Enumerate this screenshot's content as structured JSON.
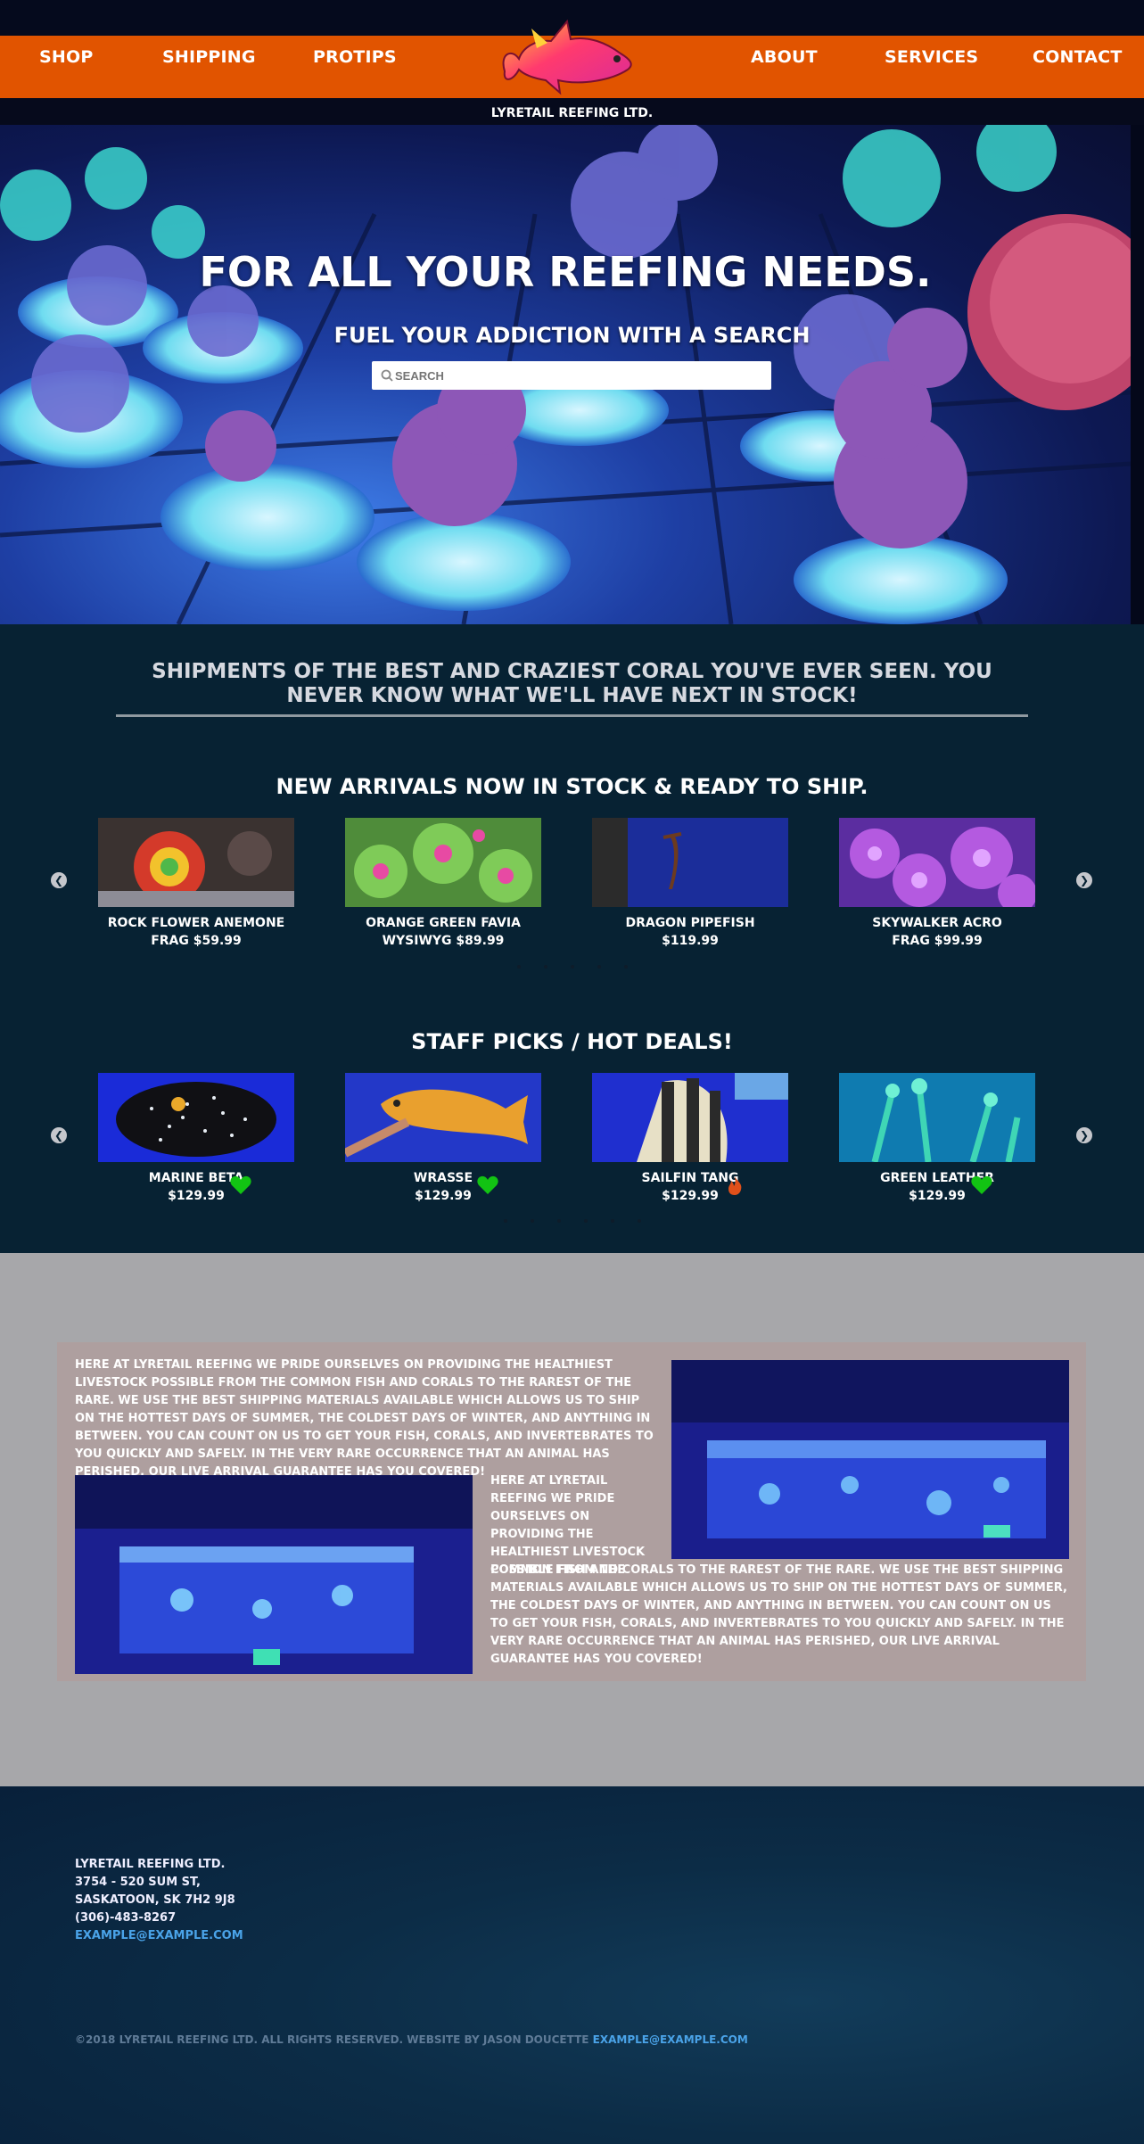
{
  "nav": {
    "left": [
      "SHOP",
      "SHIPPING",
      "PROTIPS"
    ],
    "right": [
      "ABOUT",
      "SERVICES",
      "CONTACT"
    ],
    "brand": "LYRETAIL REEFING LTD."
  },
  "hero": {
    "title": "FOR ALL YOUR REEFING NEEDS.",
    "subtitle": "FUEL YOUR ADDICTION WITH A SEARCH",
    "search_placeholder": "SEARCH",
    "search_icon": "search-icon"
  },
  "tagline": "SHIPMENTS OF THE BEST AND CRAZIEST CORAL YOU'VE EVER SEEN. YOU NEVER KNOW WHAT WE'LL HAVE NEXT IN STOCK!",
  "new_arrivals": {
    "title": "NEW ARRIVALS NOW IN STOCK & READY TO SHIP.",
    "items": [
      {
        "name": "ROCK FLOWER ANEMONE",
        "price": "FRAG $59.99"
      },
      {
        "name": "ORANGE GREEN FAVIA",
        "price": "WYSIWYG $89.99"
      },
      {
        "name": "DRAGON PIPEFISH",
        "price": "$119.99"
      },
      {
        "name": "SKYWALKER ACRO",
        "price": "FRAG $99.99"
      }
    ]
  },
  "staff_picks": {
    "title": "STAFF PICKS / HOT DEALS!",
    "items": [
      {
        "name": "MARINE BETA",
        "price": "$129.99",
        "badge": "heart-icon"
      },
      {
        "name": "WRASSE",
        "price": "$129.99",
        "badge": "heart-icon"
      },
      {
        "name": "SAILFIN TANG",
        "price": "$129.99",
        "badge": "flame-icon"
      },
      {
        "name": "GREEN LEATHER",
        "price": "$129.99",
        "badge": "heart-icon"
      }
    ]
  },
  "about": {
    "paragraph1": "HERE AT LYRETAIL REEFING WE PRIDE OURSELVES ON PROVIDING THE HEALTHIEST LIVESTOCK POSSIBLE FROM THE COMMON FISH AND CORALS TO THE RAREST OF THE RARE. WE USE THE BEST SHIPPING MATERIALS AVAILABLE WHICH ALLOWS US TO SHIP ON THE HOTTEST DAYS OF SUMMER, THE COLDEST DAYS OF WINTER, AND ANYTHING IN BETWEEN. YOU CAN COUNT ON US TO GET YOUR FISH, CORALS, AND INVERTEBRATES TO YOU QUICKLY AND SAFELY. IN THE VERY RARE OCCURRENCE THAT AN ANIMAL HAS PERISHED, OUR LIVE ARRIVAL GUARANTEE HAS YOU COVERED!",
    "paragraph2a": "HERE AT LYRETAIL REEFING WE PRIDE OURSELVES ON PROVIDING THE HEALTHIEST LIVESTOCK POSSIBLE FROM THE",
    "paragraph2b": "COMMON FISH AND CORALS TO THE RAREST OF THE RARE. WE USE THE BEST SHIPPING MATERIALS AVAILABLE WHICH ALLOWS US TO SHIP ON THE HOTTEST DAYS OF SUMMER, THE COLDEST DAYS OF WINTER, AND ANYTHING IN BETWEEN. YOU CAN COUNT ON US TO GET YOUR FISH, CORALS, AND INVERTEBRATES TO YOU QUICKLY AND SAFELY. IN THE VERY RARE OCCURRENCE THAT AN ANIMAL HAS PERISHED, OUR LIVE ARRIVAL GUARANTEE HAS YOU COVERED!"
  },
  "footer": {
    "company": "LYRETAIL REEFING LTD.",
    "street": "3754 - 520 SUM ST,",
    "city": "SASKATOON, SK 7H2 9J8",
    "phone": "(306)-483-8267",
    "email": "EXAMPLE@EXAMPLE.COM",
    "copyright": "©2018 LYRETAIL REEFING LTD. ALL RIGHTS RESERVED. WEBSITE BY JASON DOUCETTE",
    "copyright_email": "EXAMPLE@EXAMPLE.COM"
  },
  "colors": {
    "nav_orange": "#e15400",
    "dark_section": "#072233",
    "gray_section": "#a7a7aa",
    "about_box": "#ae9f9f",
    "heart_green": "#12c313",
    "flame_orange": "#e0501a",
    "link_blue": "#4aa3e8"
  }
}
